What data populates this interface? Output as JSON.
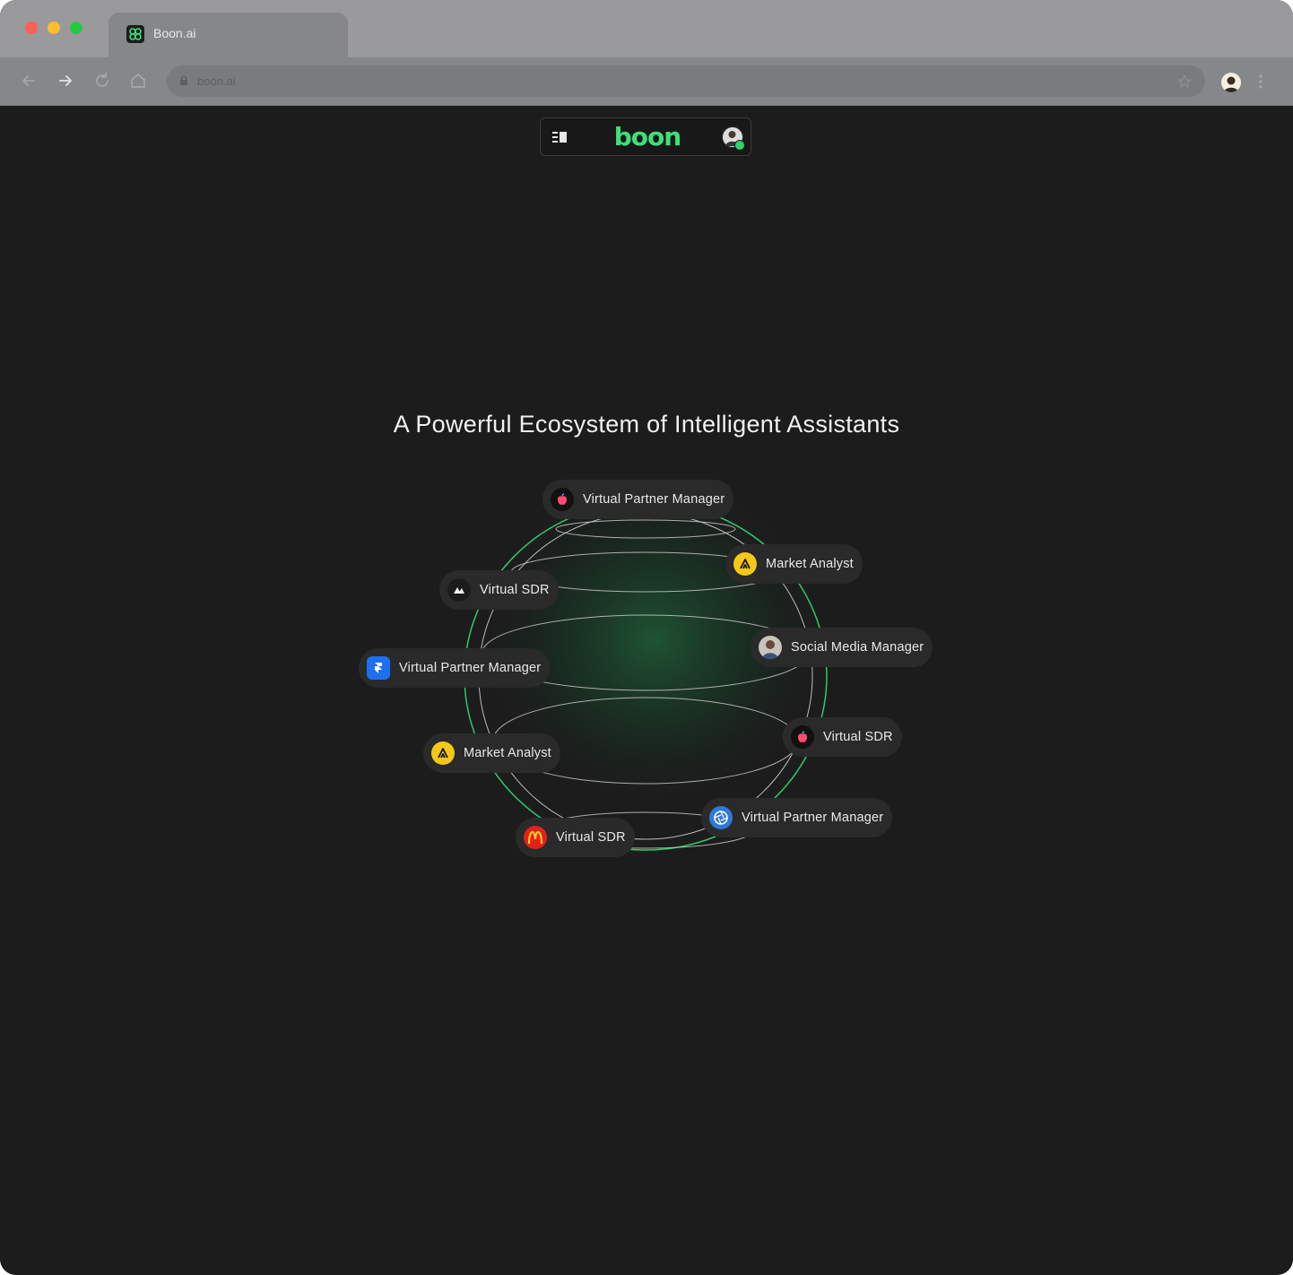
{
  "browser": {
    "tab_title": "Boon.ai",
    "url": "boon.ai"
  },
  "nav": {
    "logo_text": "boon",
    "brand_color": "#3ee07a"
  },
  "headline": "A Powerful Ecosystem of Intelligent Assistants",
  "assistants": [
    {
      "label": "Virtual Partner Manager",
      "icon": "apple-logo-icon"
    },
    {
      "label": "Market Analyst",
      "icon": "analyst-a-icon"
    },
    {
      "label": "Virtual SDR",
      "icon": "abstract-a-icon"
    },
    {
      "label": "Social Media Manager",
      "icon": "person-avatar-icon"
    },
    {
      "label": "Virtual Partner Manager",
      "icon": "framer-logo-icon"
    },
    {
      "label": "Virtual SDR",
      "icon": "apple-logo-icon"
    },
    {
      "label": "Market Analyst",
      "icon": "analyst-a-icon"
    },
    {
      "label": "Virtual Partner Manager",
      "icon": "aperture-icon"
    },
    {
      "label": "Virtual SDR",
      "icon": "mcdonalds-logo-icon"
    }
  ]
}
